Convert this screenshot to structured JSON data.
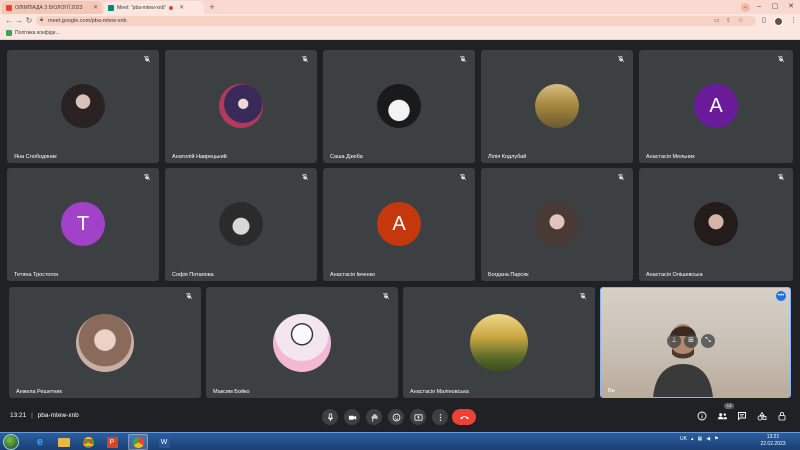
{
  "browser": {
    "tabs": [
      {
        "label": "ОЛІМПІАДА З БІОЛОГІЇ 2023",
        "favicon_color": "#ea4335",
        "active": false
      },
      {
        "label": "Meet: \"pba-mtew-xnb\"",
        "favicon_color": "#00897b",
        "active": true
      }
    ],
    "url": "meet.google.com/pba-mtew-xnb",
    "bookmark": "Політика конфіде..."
  },
  "meet": {
    "participants": [
      {
        "name": "Яна Слободяник",
        "avatar": "photo",
        "muted": true
      },
      {
        "name": "Анатолій Наврецький",
        "avatar": "photo",
        "muted": true
      },
      {
        "name": "Саша Дзюба",
        "avatar": "photo",
        "muted": true
      },
      {
        "name": "Лілія Кодлубай",
        "avatar": "photo",
        "muted": true
      },
      {
        "name": "Анастасія Мельник",
        "avatar": "letter",
        "letter": "A",
        "color": "#6a1b9a",
        "muted": true
      },
      {
        "name": "Тетяна Тростогон",
        "avatar": "letter",
        "letter": "T",
        "color": "#a142c9",
        "muted": true
      },
      {
        "name": "Софія Потапова",
        "avatar": "photo",
        "muted": true
      },
      {
        "name": "Анастасія Івченко",
        "avatar": "letter",
        "letter": "A",
        "color": "#c5380e",
        "muted": true
      },
      {
        "name": "Богдана Парсяк",
        "avatar": "photo",
        "muted": true
      },
      {
        "name": "Анастасія Олішевська",
        "avatar": "photo",
        "muted": true
      },
      {
        "name": "Анжела Решетник",
        "avatar": "photo",
        "muted": true
      },
      {
        "name": "Максим Бойко",
        "avatar": "photo",
        "muted": true
      },
      {
        "name": "Анастасія Маліновська",
        "avatar": "photo",
        "muted": true
      }
    ],
    "self_label": "Ви",
    "time": "13:21",
    "separator": "|",
    "meeting_code": "pba-mtew-xnb",
    "people_count": "14"
  },
  "taskbar": {
    "language": "UK",
    "clock_time": "13:21",
    "clock_date": "22.02.2023"
  },
  "colors": {
    "accent_blue": "#1a73e8",
    "end_call_red": "#ea4335",
    "tile_bg": "#3c4043",
    "meet_bg": "#202124"
  }
}
